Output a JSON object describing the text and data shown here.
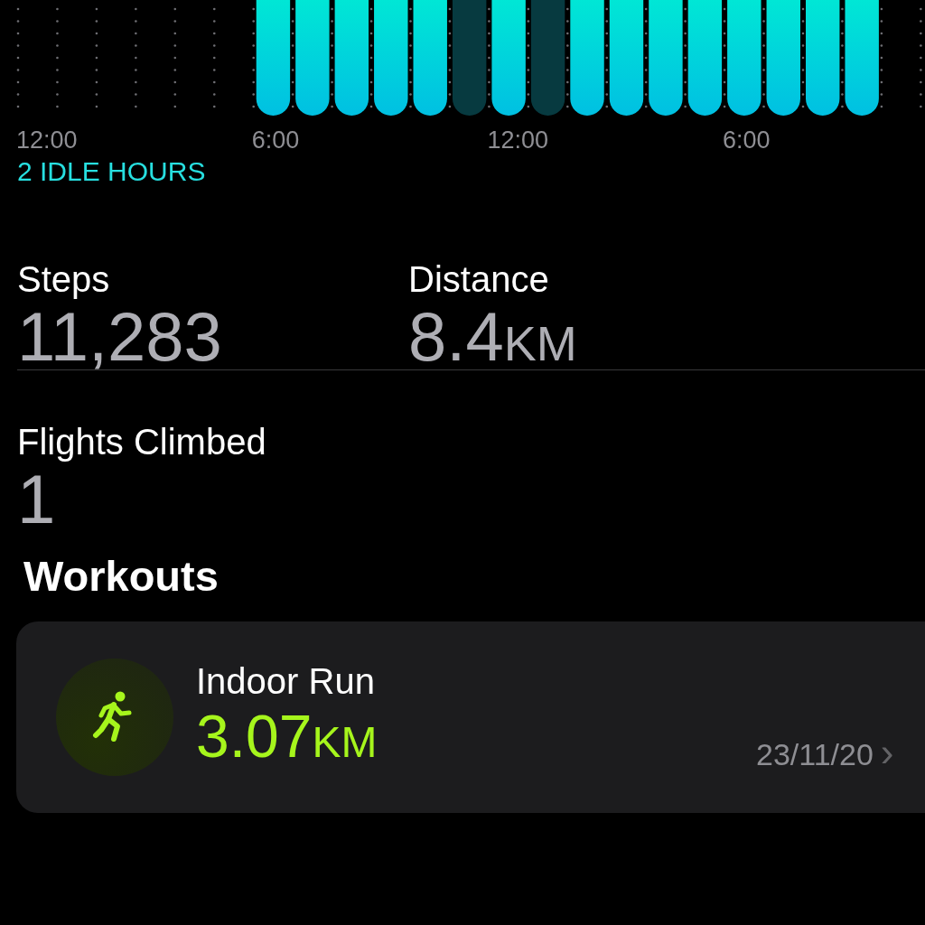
{
  "stand_chart": {
    "hours": [
      {
        "kind": "empty"
      },
      {
        "kind": "empty"
      },
      {
        "kind": "empty"
      },
      {
        "kind": "empty"
      },
      {
        "kind": "empty"
      },
      {
        "kind": "empty"
      },
      {
        "kind": "stand"
      },
      {
        "kind": "stand"
      },
      {
        "kind": "stand"
      },
      {
        "kind": "stand"
      },
      {
        "kind": "stand"
      },
      {
        "kind": "idle"
      },
      {
        "kind": "stand"
      },
      {
        "kind": "idle"
      },
      {
        "kind": "stand"
      },
      {
        "kind": "stand"
      },
      {
        "kind": "stand"
      },
      {
        "kind": "stand"
      },
      {
        "kind": "stand"
      },
      {
        "kind": "stand"
      },
      {
        "kind": "stand"
      },
      {
        "kind": "stand"
      },
      {
        "kind": "empty"
      }
    ],
    "axis_labels": [
      "12:00",
      "6:00",
      "12:00",
      "6:00"
    ],
    "summary": "2 IDLE HOURS"
  },
  "stats": [
    {
      "label": "Steps",
      "value": "11,283"
    },
    {
      "label": "Distance",
      "value": "8.4",
      "unit": "KM"
    },
    {
      "label": "Flights Climbed",
      "value": "1"
    }
  ],
  "workouts": {
    "title": "Workouts",
    "items": [
      {
        "name": "Indoor Run",
        "value": "3.07",
        "unit": "KM",
        "date": "23/11/20",
        "chevron": "›"
      }
    ]
  }
}
